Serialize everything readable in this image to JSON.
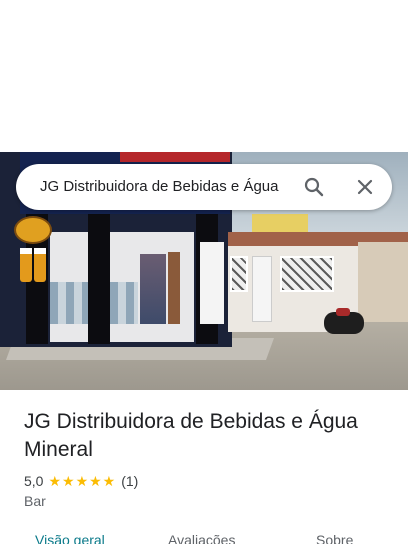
{
  "search": {
    "query": "JG Distribuidora de Bebidas e Água"
  },
  "place": {
    "name": "JG Distribuidora de Bebidas e Água Mineral",
    "rating": "5,0",
    "stars": "★★★★★",
    "review_count": "(1)",
    "category": "Bar"
  },
  "tabs": [
    {
      "label": "Visão geral"
    },
    {
      "label": "Avaliações"
    },
    {
      "label": "Sobre"
    }
  ],
  "colors": {
    "accent_tab": "#0b7a8a",
    "star": "#fbbc04"
  },
  "icons": {
    "search": "search-icon",
    "close": "close-icon"
  }
}
